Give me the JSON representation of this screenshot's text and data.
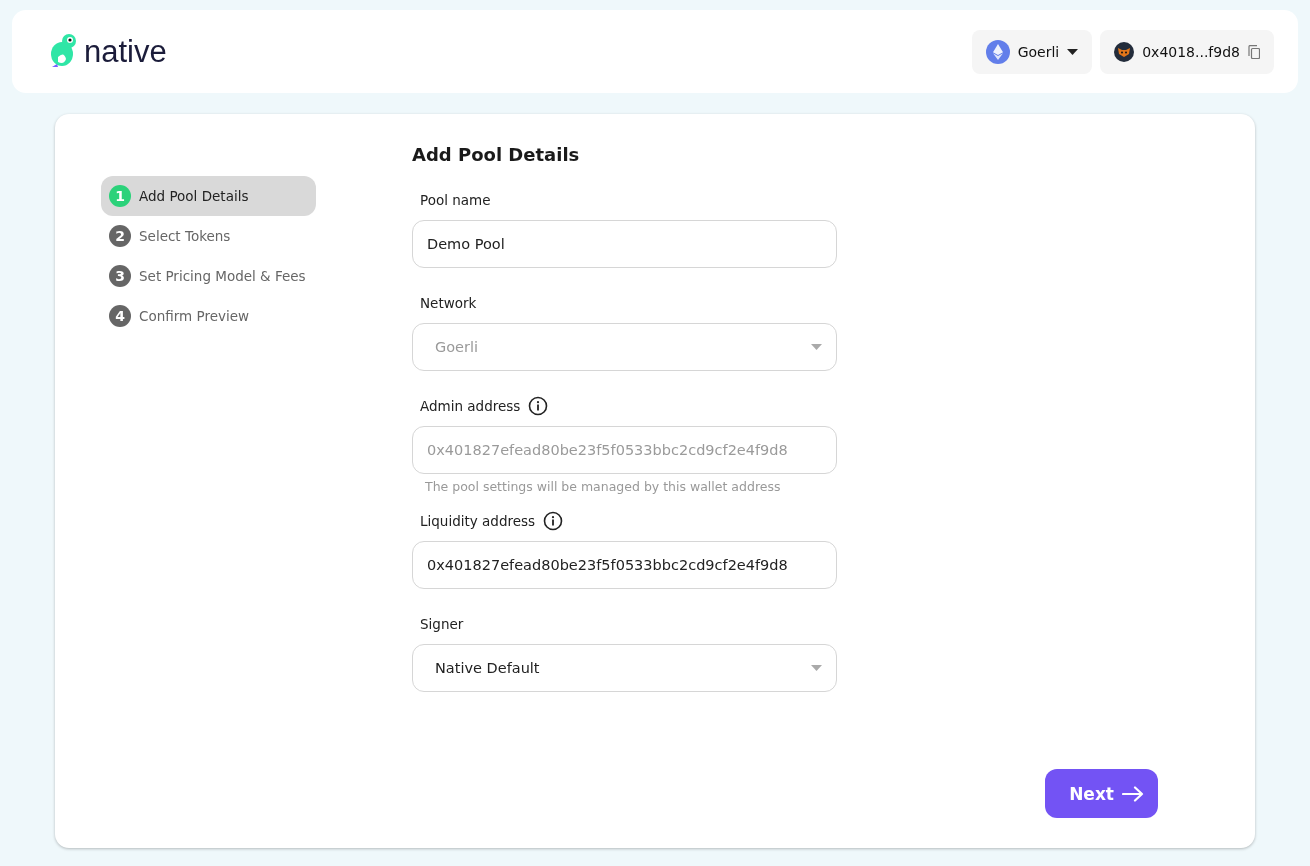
{
  "header": {
    "logo_text": "native",
    "network": {
      "label": "Goerli"
    },
    "wallet": {
      "address": "0x4018...f9d8"
    }
  },
  "steps": [
    {
      "number": "1",
      "label": "Add Pool Details",
      "selected": true
    },
    {
      "number": "2",
      "label": "Select Tokens",
      "selected": false
    },
    {
      "number": "3",
      "label": "Set Pricing Model & Fees",
      "selected": false
    },
    {
      "number": "4",
      "label": "Confirm Preview",
      "selected": false
    }
  ],
  "form": {
    "title": "Add Pool Details",
    "fields": [
      {
        "kind": "text",
        "label": "Pool name",
        "value": "Demo Pool",
        "disabled": false,
        "info": false
      },
      {
        "kind": "select",
        "label": "Network",
        "value": "Goerli",
        "disabled": true,
        "info": false
      },
      {
        "kind": "text",
        "label": "Admin address",
        "value": "0x401827efead80be23f5f0533bbc2cd9cf2e4f9d8",
        "disabled": true,
        "info": true,
        "help": "The pool settings will be managed by this wallet address"
      },
      {
        "kind": "text",
        "label": "Liquidity address",
        "value": "0x401827efead80be23f5f0533bbc2cd9cf2e4f9d8",
        "disabled": false,
        "info": true
      },
      {
        "kind": "select",
        "label": "Signer",
        "value": "Native Default",
        "disabled": false,
        "info": false
      }
    ]
  },
  "next_button": {
    "label": "Next"
  }
}
